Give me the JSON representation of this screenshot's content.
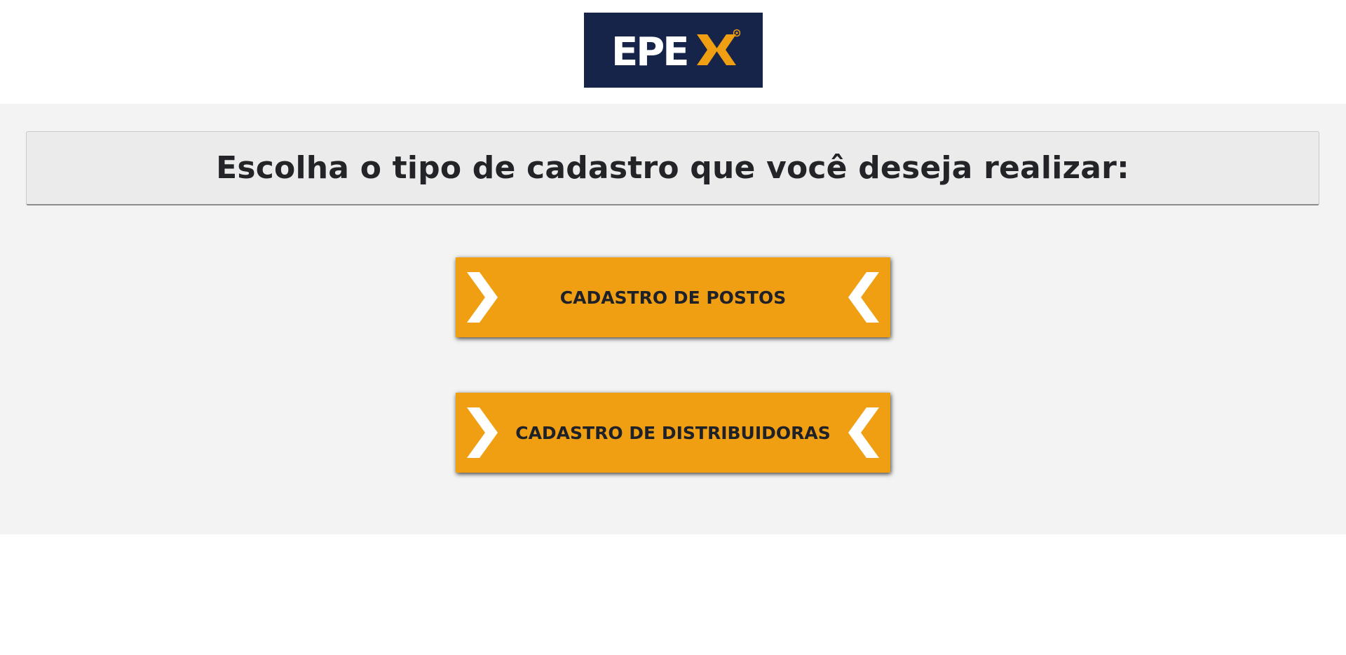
{
  "header": {
    "logo": {
      "text": "EPEX",
      "colors": {
        "background": "#17244a",
        "text": "#ffffff",
        "accent": "#f09f12"
      }
    }
  },
  "main": {
    "title": "Escolha o tipo de cadastro que você deseja realizar:",
    "buttons": [
      {
        "label": "CADASTRO DE POSTOS",
        "icons": [
          "chevron-right-icon",
          "chevron-left-icon"
        ]
      },
      {
        "label": "CADASTRO DE DISTRIBUIDORAS",
        "icons": [
          "chevron-right-icon",
          "chevron-left-icon"
        ]
      }
    ]
  },
  "colors": {
    "button_background": "#f09f12",
    "button_text": "#1f2128",
    "chevron": "#ffffff",
    "panel_background": "#f3f3f3",
    "title_box_background": "#ebebeb"
  }
}
